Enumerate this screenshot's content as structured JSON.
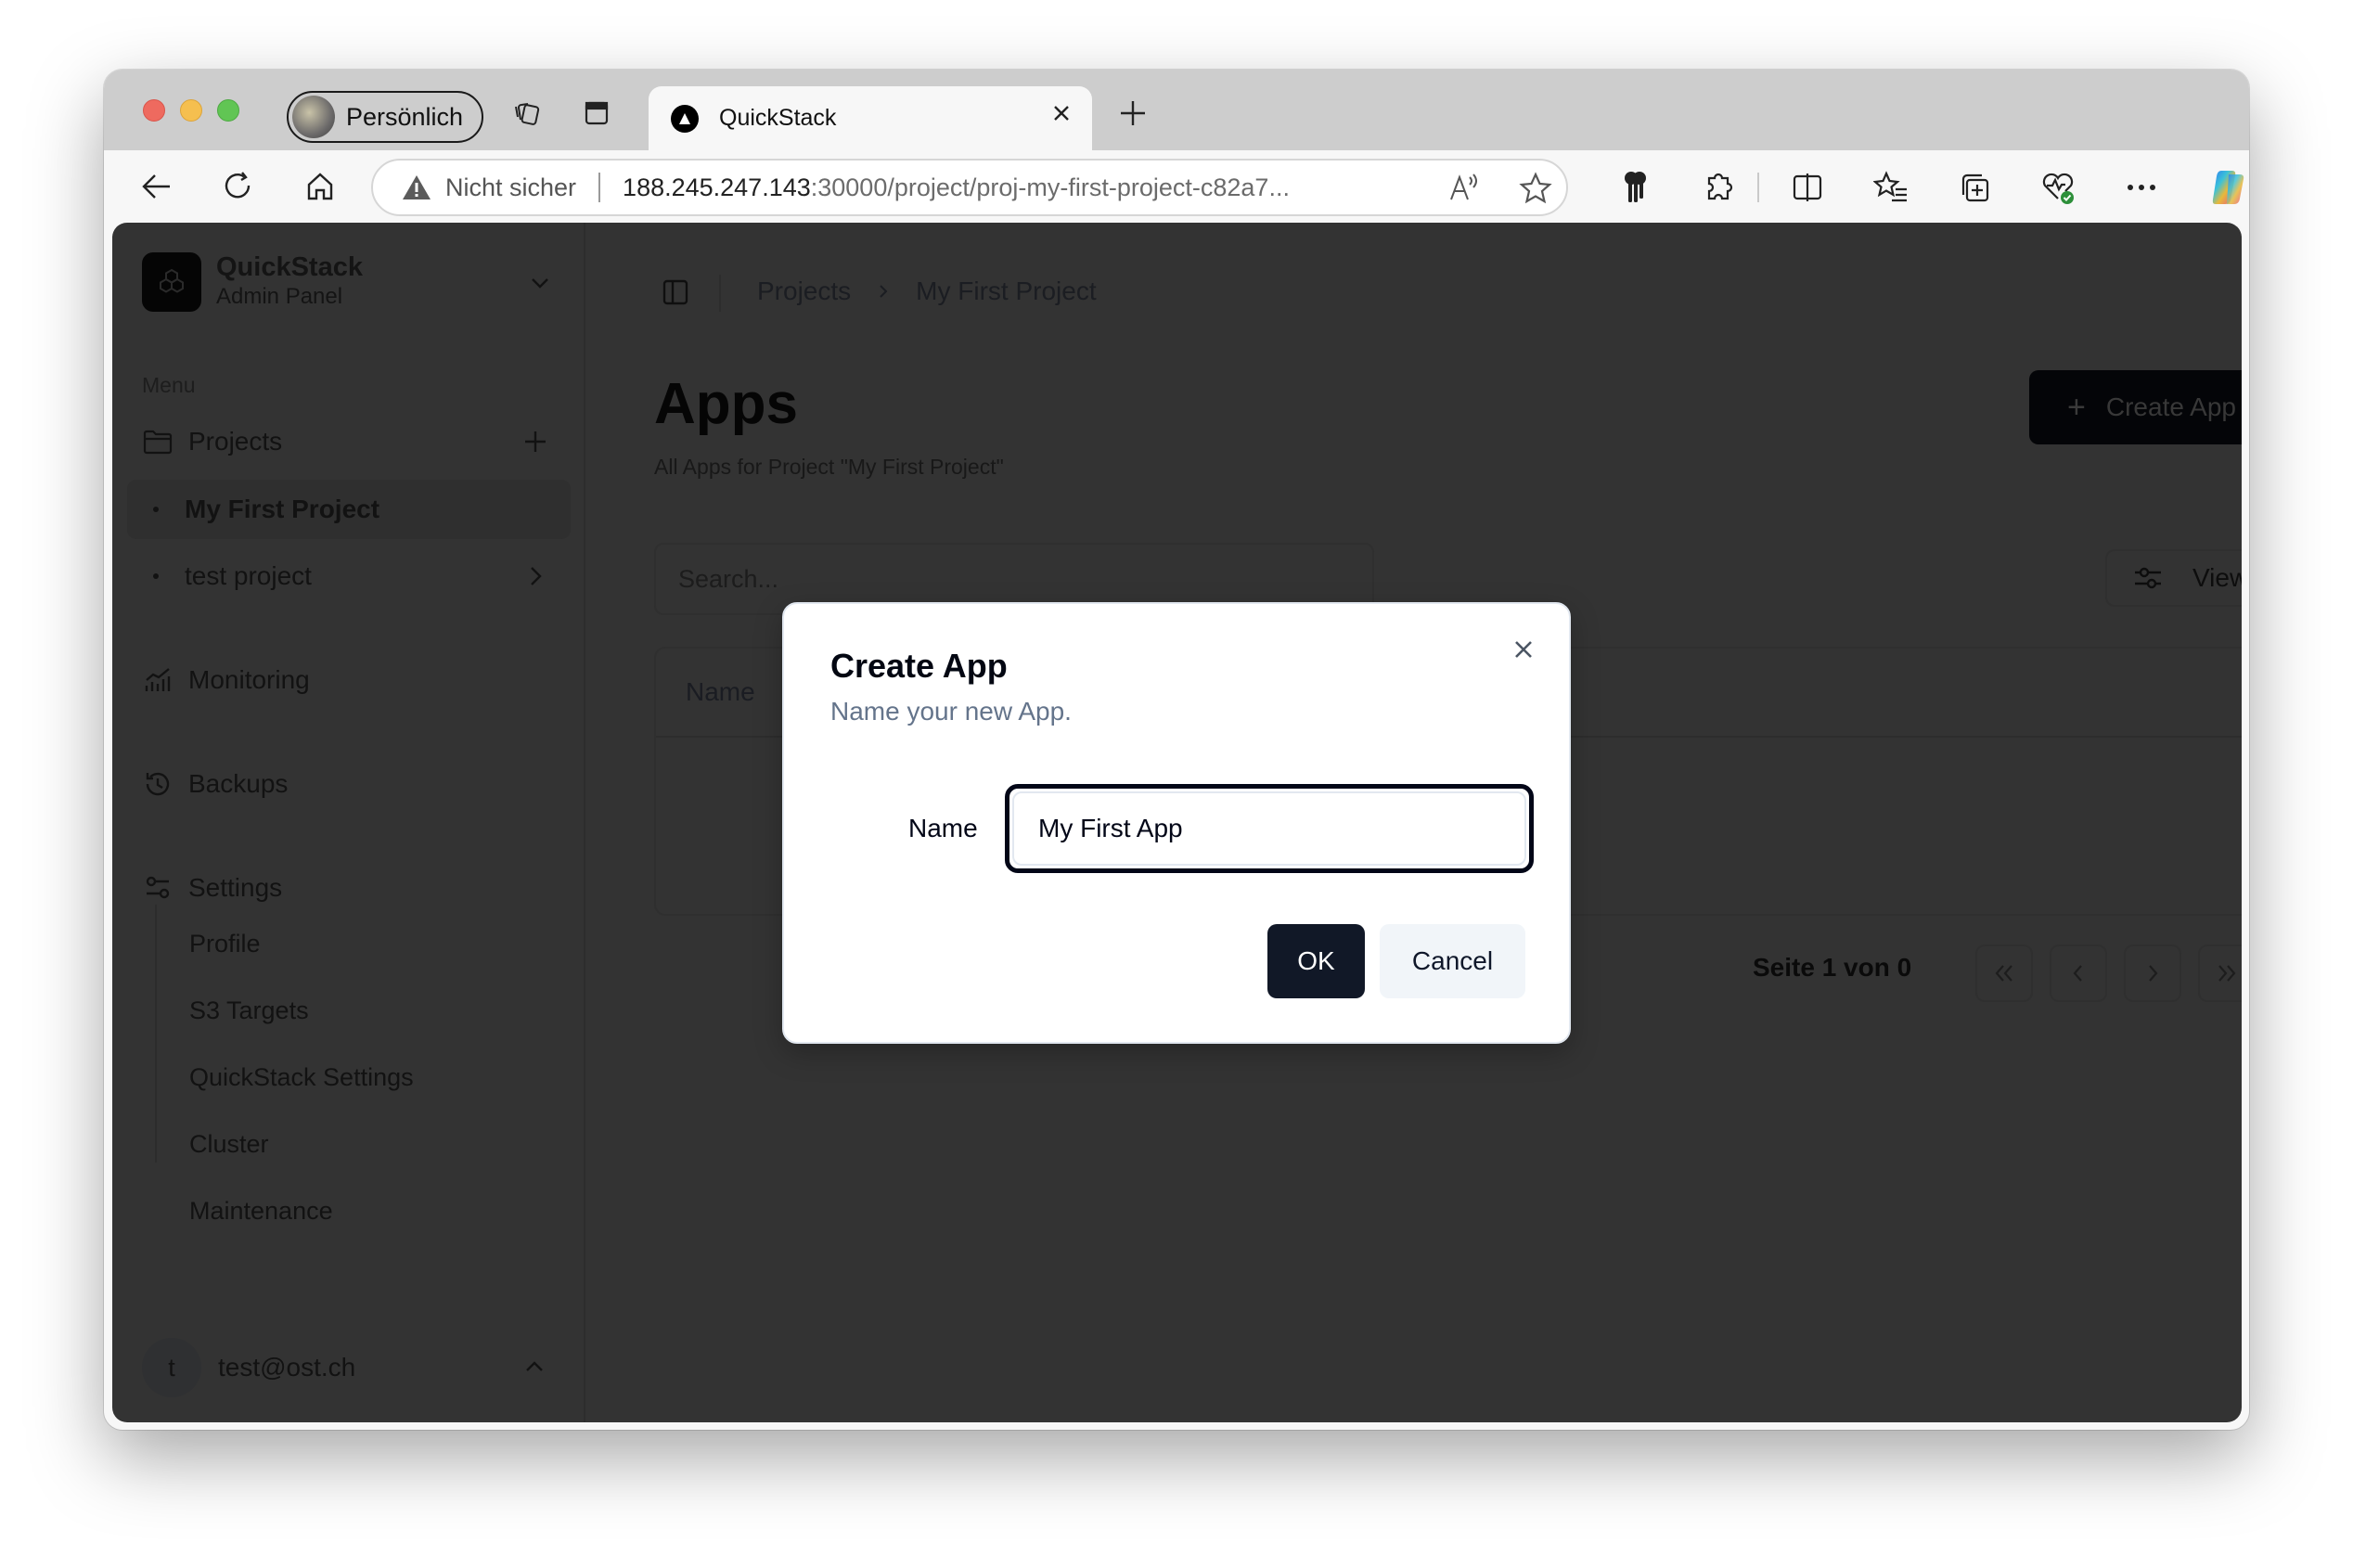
{
  "browser": {
    "profile_label": "Persönlich",
    "tab_title": "QuickStack",
    "security_label": "Nicht sicher",
    "url_host": "188.245.247.143",
    "url_rest": ":30000/project/proj-my-first-project-c82a7..."
  },
  "sidebar": {
    "brand_name": "QuickStack",
    "brand_sub": "Admin Panel",
    "menu_label": "Menu",
    "projects_label": "Projects",
    "projects": [
      {
        "label": "My First Project",
        "active": true
      },
      {
        "label": "test project",
        "active": false
      }
    ],
    "monitoring_label": "Monitoring",
    "backups_label": "Backups",
    "settings_label": "Settings",
    "settings_items": [
      "Profile",
      "S3 Targets",
      "QuickStack Settings",
      "Cluster",
      "Maintenance"
    ],
    "user_initial": "t",
    "user_email": "test@ost.ch"
  },
  "main": {
    "breadcrumb": [
      "Projects",
      "My First Project"
    ],
    "title": "Apps",
    "subtitle": "All Apps for Project \"My First Project\"",
    "create_button": "Create App",
    "search_placeholder": "Search...",
    "view_button": "View",
    "table_headers": [
      "Name"
    ],
    "pager_label": "Seite 1 von 0"
  },
  "dialog": {
    "title": "Create App",
    "description": "Name your new App.",
    "field_label": "Name",
    "field_value": "My First App",
    "ok_label": "OK",
    "cancel_label": "Cancel"
  }
}
